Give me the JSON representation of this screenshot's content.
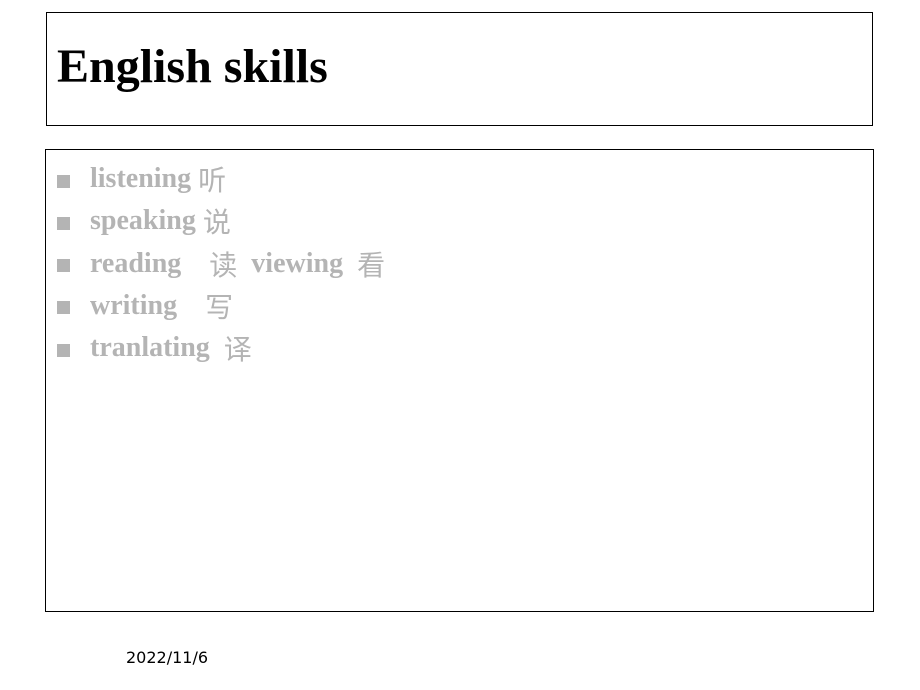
{
  "slide": {
    "title": "English skills",
    "bullets": [
      {
        "text": "listening ",
        "cjk": "听"
      },
      {
        "text": "speaking ",
        "cjk": "说"
      },
      {
        "text": "reading    ",
        "cjk": "读",
        "text2": "  viewing  ",
        "cjk2": "看"
      },
      {
        "text": "writing    ",
        "cjk": "写"
      },
      {
        "text": "tranlating  ",
        "cjk": "译"
      }
    ],
    "date": "2022/11/6"
  },
  "colors": {
    "bullet_text": "#b4b4b4",
    "title_text": "#000000",
    "border": "#000000"
  }
}
